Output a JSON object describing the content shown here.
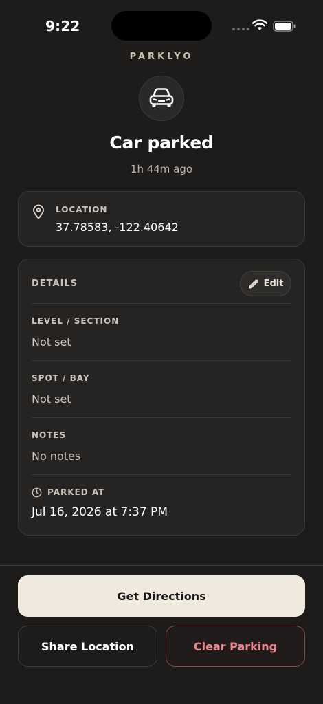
{
  "status_bar": {
    "time": "9:22"
  },
  "brand": "PARKLYO",
  "hero": {
    "title": "Car parked",
    "subtitle": "1h 44m ago"
  },
  "location": {
    "label": "LOCATION",
    "value": "37.78583, -122.40642"
  },
  "details": {
    "heading": "DETAILS",
    "edit_label": "Edit",
    "fields": [
      {
        "label": "LEVEL / SECTION",
        "value": "Not set"
      },
      {
        "label": "SPOT / BAY",
        "value": "Not set"
      },
      {
        "label": "NOTES",
        "value": "No notes"
      }
    ],
    "parked_at": {
      "label": "PARKED AT",
      "value": "Jul 16, 2026 at 7:37 PM"
    }
  },
  "actions": {
    "directions": "Get Directions",
    "share": "Share Location",
    "clear": "Clear Parking"
  },
  "colors": {
    "background": "#1d1c1b",
    "card": "#252423",
    "accent_primary": "#efe9de",
    "danger": "#e8858a"
  },
  "icons": [
    "wifi-icon",
    "battery-icon",
    "car-icon",
    "location-pin-icon",
    "pencil-icon",
    "clock-icon"
  ]
}
